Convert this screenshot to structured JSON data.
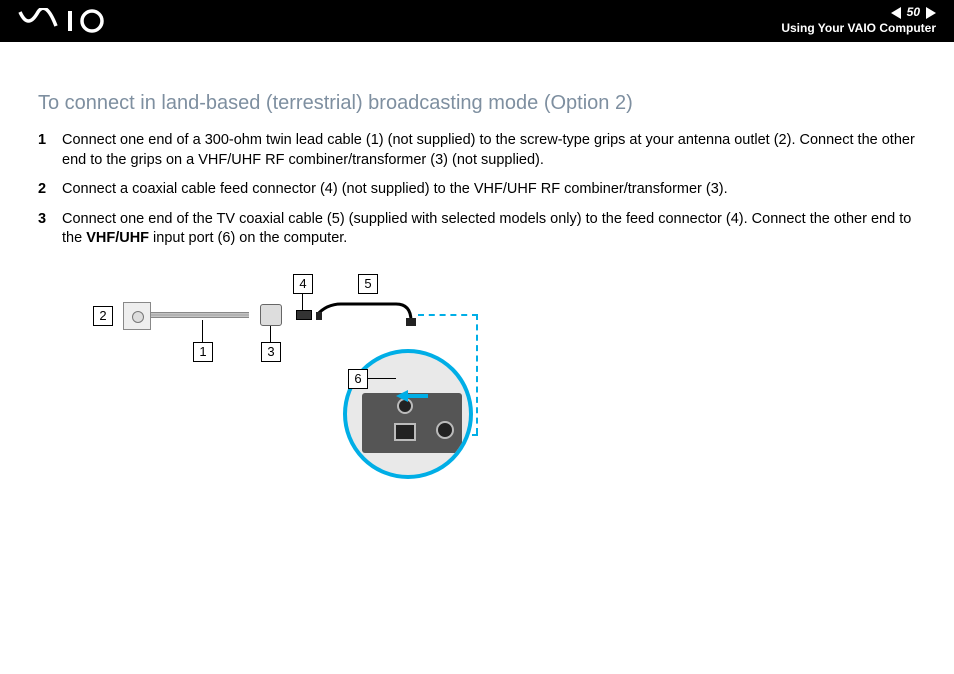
{
  "header": {
    "page_number": "50",
    "section": "Using Your VAIO Computer"
  },
  "heading": "To connect in land-based (terrestrial) broadcasting mode (Option 2)",
  "steps": [
    {
      "num": "1",
      "text": "Connect one end of a 300-ohm twin lead cable (1) (not supplied) to the screw-type grips at your antenna outlet (2). Connect the other end to the grips on a VHF/UHF RF combiner/transformer (3) (not supplied)."
    },
    {
      "num": "2",
      "text": "Connect a coaxial cable feed connector (4) (not supplied) to the VHF/UHF RF combiner/transformer (3)."
    },
    {
      "num": "3",
      "text_before": "Connect one end of the TV coaxial cable (5) (supplied with selected models only) to the feed connector (4). Connect the other end to the ",
      "bold": "VHF/UHF",
      "text_after": " input port (6) on the computer."
    }
  ],
  "callouts": {
    "c1": "1",
    "c2": "2",
    "c3": "3",
    "c4": "4",
    "c5": "5",
    "c6": "6"
  }
}
